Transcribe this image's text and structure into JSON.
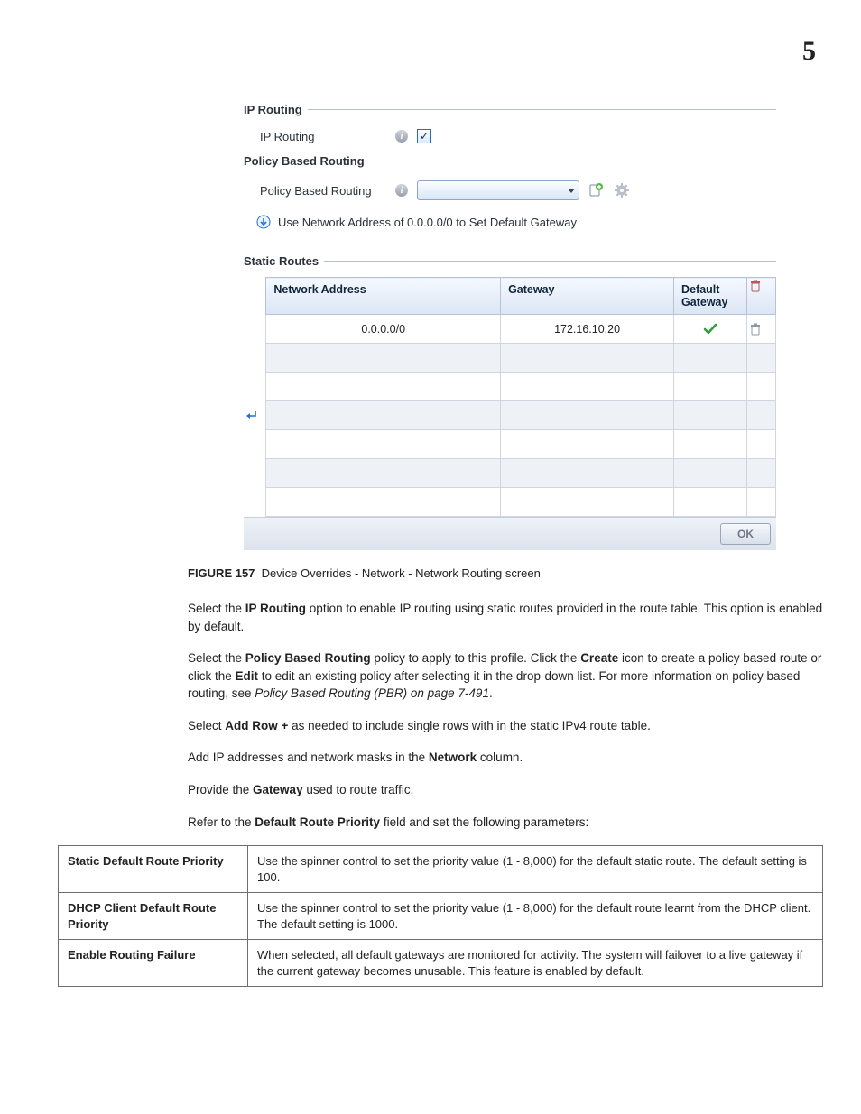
{
  "page_number": "5",
  "screenshot": {
    "ip_routing_section_title": "IP Routing",
    "ip_routing_label": "IP Routing",
    "ip_routing_checked": "✓",
    "pbr_section_title": "Policy Based Routing",
    "pbr_label": "Policy Based Routing",
    "hint_text": "Use Network Address of 0.0.0.0/0 to Set Default Gateway",
    "static_routes_title": "Static Routes",
    "cols": {
      "addr": "Network Address",
      "gw": "Gateway",
      "dg": "Default Gateway"
    },
    "row1": {
      "addr": "0.0.0.0/0",
      "gw": "172.16.10.20"
    },
    "ok_label": "OK"
  },
  "figure": {
    "label": "FIGURE 157",
    "caption": "Device Overrides - Network - Network Routing screen"
  },
  "para1": {
    "t1": "Select the ",
    "b1": "IP Routing",
    "t2": " option to enable IP routing using static routes provided in the route table. This option is enabled by default."
  },
  "para2": {
    "t1": "Select the ",
    "b1": "Policy Based Routing",
    "t2": " policy to apply to this profile. Click the ",
    "b2": "Create",
    "t3": " icon to create a policy based route or click the ",
    "b3": "Edit",
    "t4": " to edit an existing policy after selecting it in the drop-down list. For more information on policy based routing, see ",
    "i1": "Policy Based Routing (PBR) on page 7-491",
    "t5": "."
  },
  "para3": {
    "t1": "Select ",
    "b1": "Add Row +",
    "t2": " as needed to include single rows with in the static IPv4 route table."
  },
  "para4": {
    "t1": "Add IP addresses and network masks in the ",
    "b1": "Network",
    "t2": " column."
  },
  "para5": {
    "t1": "Provide the ",
    "b1": "Gateway",
    "t2": " used to route traffic."
  },
  "para6": {
    "t1": "Refer to the ",
    "b1": "Default Route Priority",
    "t2": " field and set the following parameters:"
  },
  "params": {
    "r1": {
      "name": "Static Default Route Priority",
      "desc": "Use the spinner control to set the priority value (1 - 8,000) for the default static route. The default setting is 100."
    },
    "r2": {
      "name": "DHCP Client Default Route Priority",
      "desc": "Use the spinner control to set the priority value (1 - 8,000) for the default route learnt from the DHCP client. The default setting is 1000."
    },
    "r3": {
      "name": "Enable Routing Failure",
      "desc": "When selected, all default gateways are monitored for activity. The system will failover to a live gateway if the current gateway becomes unusable. This feature is enabled by default."
    }
  }
}
